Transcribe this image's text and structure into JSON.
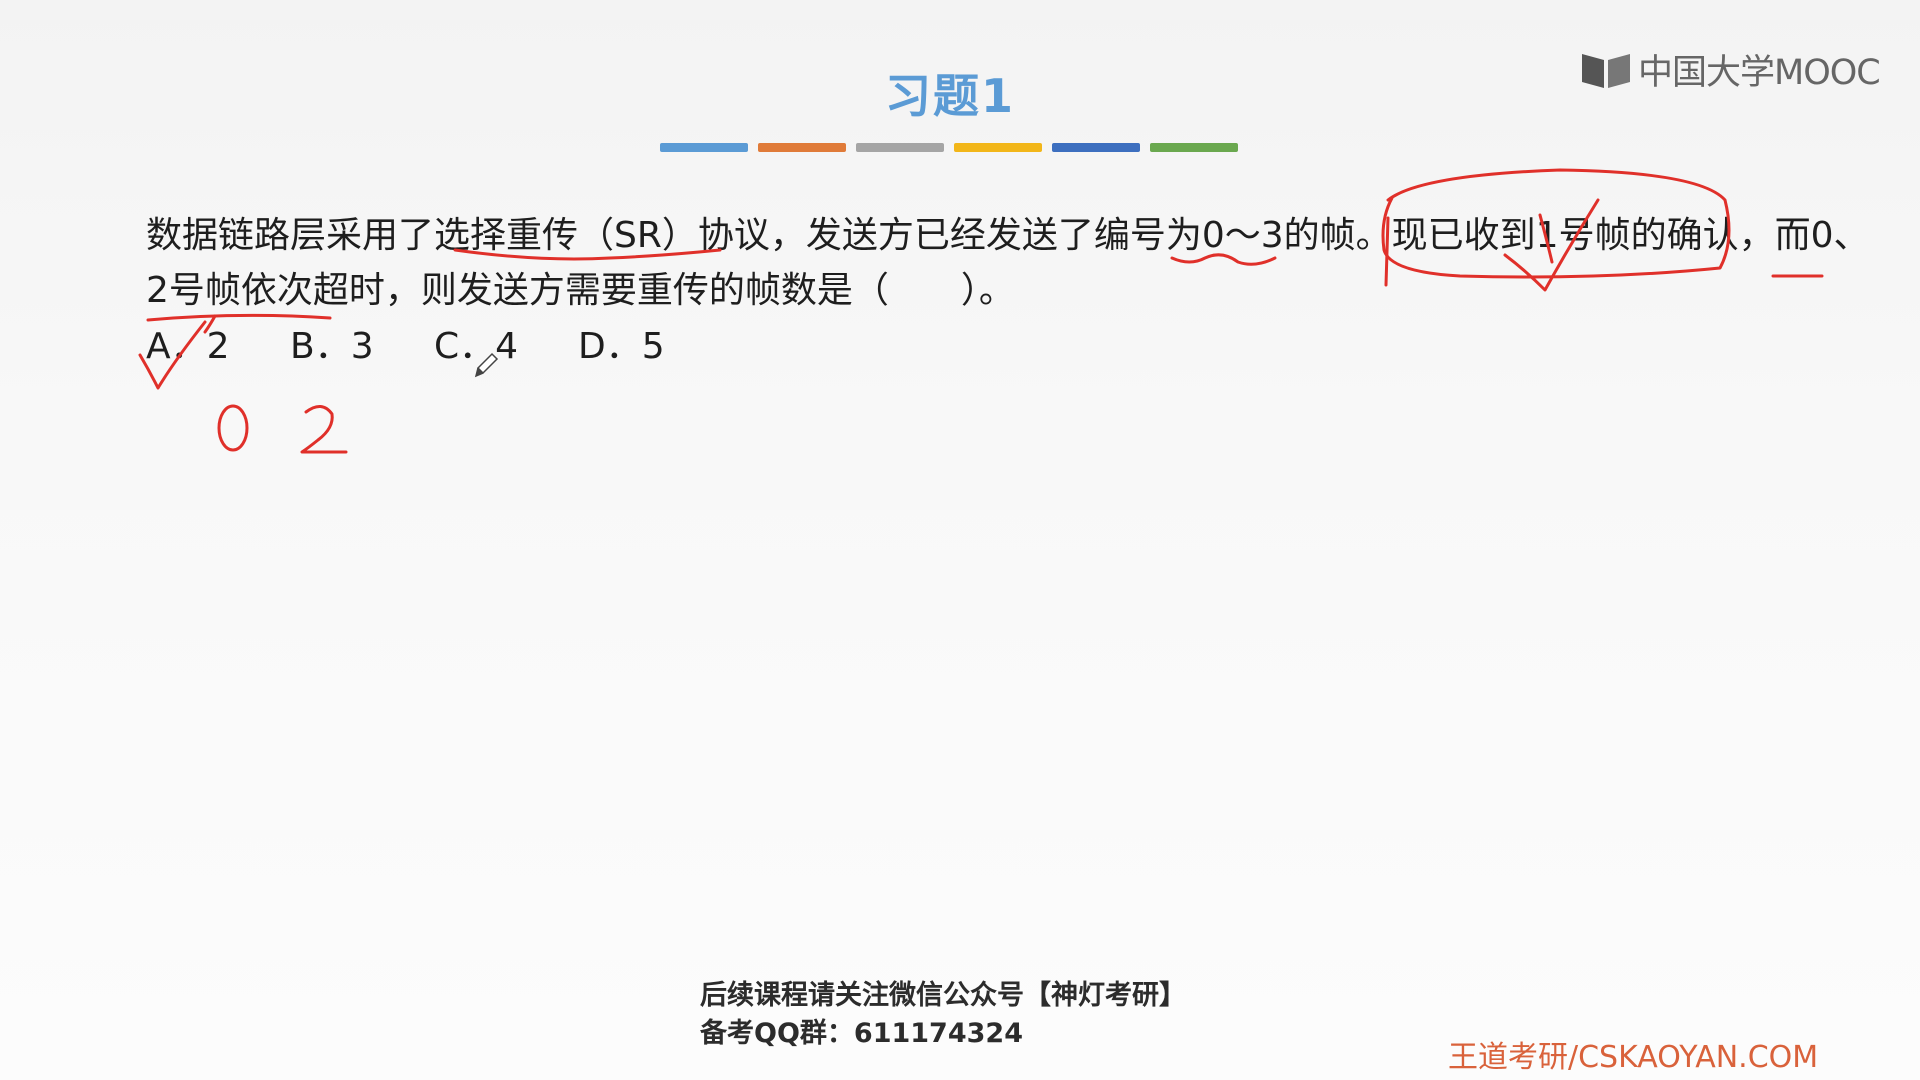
{
  "slide": {
    "title": "习题1"
  },
  "logo": {
    "text": "中国大学MOOC"
  },
  "title_bar_colors": [
    "#5b9bd5",
    "#e07b39",
    "#a5a5a5",
    "#f2b619",
    "#3d6fbf",
    "#6aa84f"
  ],
  "question": {
    "line1": "数据链路层采用了选择重传（SR）协议，发送方已经发送了编号为0～3的帧。现已收到1号帧的确认，而0、",
    "line2": "2号帧依次超时，则发送方需要重传的帧数是（　　）。"
  },
  "options": [
    {
      "label": "A．2"
    },
    {
      "label": "B．3"
    },
    {
      "label": "C．4"
    },
    {
      "label": "D．5"
    }
  ],
  "annotations": {
    "handwritten_1": "0",
    "handwritten_2": "2"
  },
  "footer": {
    "line1": "后续课程请关注微信公众号【神灯考研】",
    "line2": "备考QQ群：611174324"
  },
  "brand": {
    "text": "王道考研/CSKAOYAN.COM"
  },
  "ink_color": "#e0302a"
}
